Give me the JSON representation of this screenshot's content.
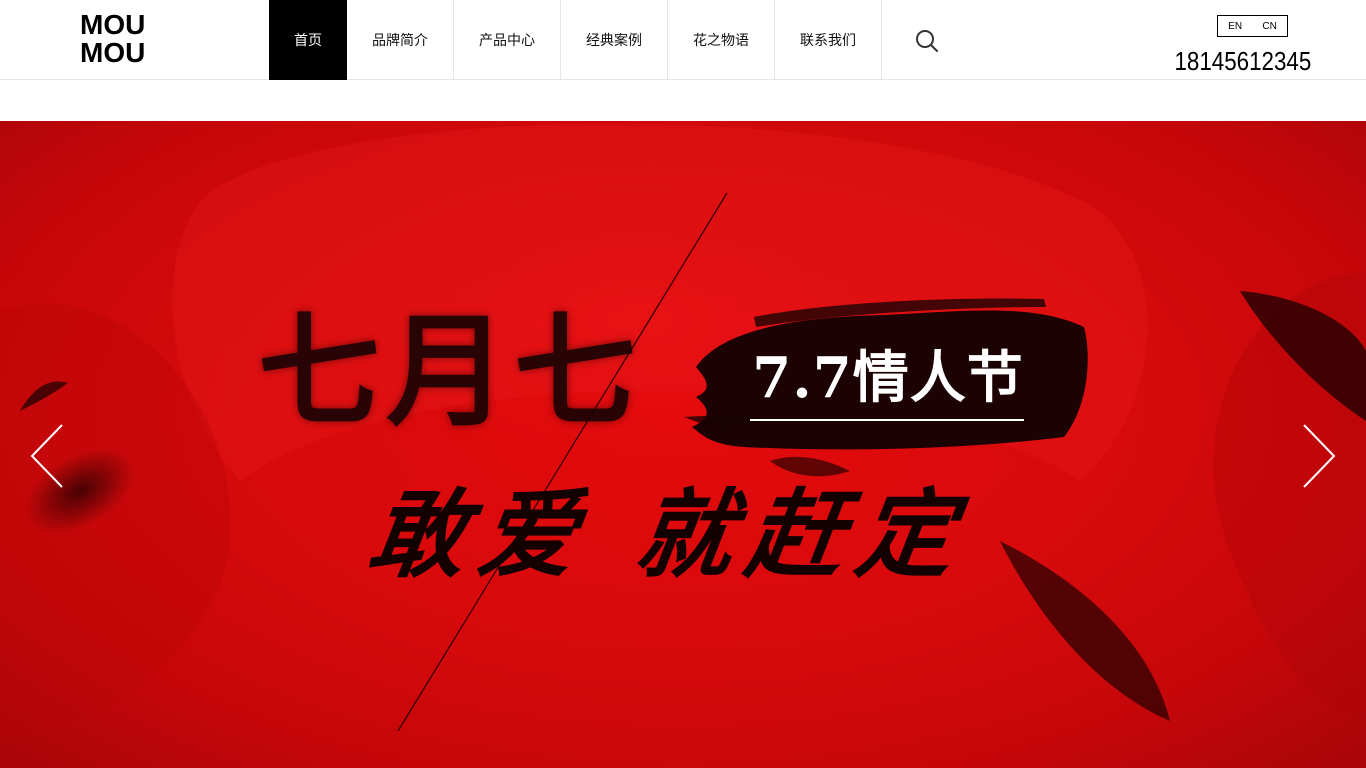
{
  "logo": {
    "line1": "MOU",
    "line2": "MOU"
  },
  "nav": {
    "items": [
      {
        "label": "首页",
        "active": true
      },
      {
        "label": "品牌简介"
      },
      {
        "label": "产品中心"
      },
      {
        "label": "经典案例"
      },
      {
        "label": "花之物语"
      },
      {
        "label": "联系我们"
      }
    ],
    "search_icon": "search-icon"
  },
  "lang": {
    "en": "EN",
    "cn": "CN"
  },
  "phone": "18145612345",
  "banner": {
    "title_main": "七月七",
    "title_badge": "7.7情人节",
    "subtitle": "敢爱 就赶定",
    "prev_icon": "chevron-left-icon",
    "next_icon": "chevron-right-icon",
    "colors": {
      "background": "#d80a0c",
      "ink": "#1a0304",
      "badge_text": "#ffffff"
    }
  }
}
